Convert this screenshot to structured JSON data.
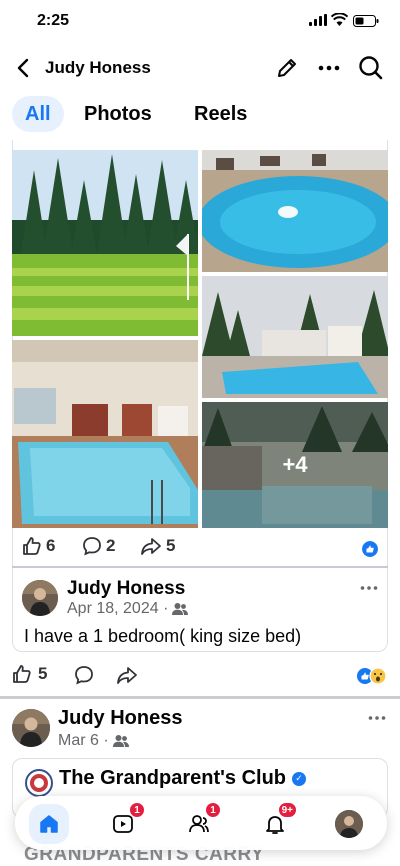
{
  "status_bar": {
    "time": "2:25"
  },
  "header": {
    "title": "Judy Honess"
  },
  "tabs": [
    {
      "label": "All",
      "active": true
    },
    {
      "label": "Photos"
    },
    {
      "label": "Reels"
    }
  ],
  "post1": {
    "more_photos_label": "+4",
    "reactions": {
      "likes": "6",
      "comments": "2",
      "shares": "5"
    }
  },
  "shared_post": {
    "author": "Judy Honess",
    "date": "Apr 18, 2024 ·",
    "text": "I have a 1 bedroom( king size bed)",
    "reactions": {
      "likes": "5"
    }
  },
  "post2": {
    "author": "Judy Honess",
    "date": "Mar 6 ·",
    "group_name": "The Grandparent's Club",
    "preview_text": "GRANDPARENTS CARRY"
  },
  "bottom_nav": {
    "video_badge": "1",
    "friends_badge": "1",
    "notifications_badge": "9+"
  },
  "colors": {
    "brand": "#1877f2",
    "badge": "#e41e3f"
  }
}
